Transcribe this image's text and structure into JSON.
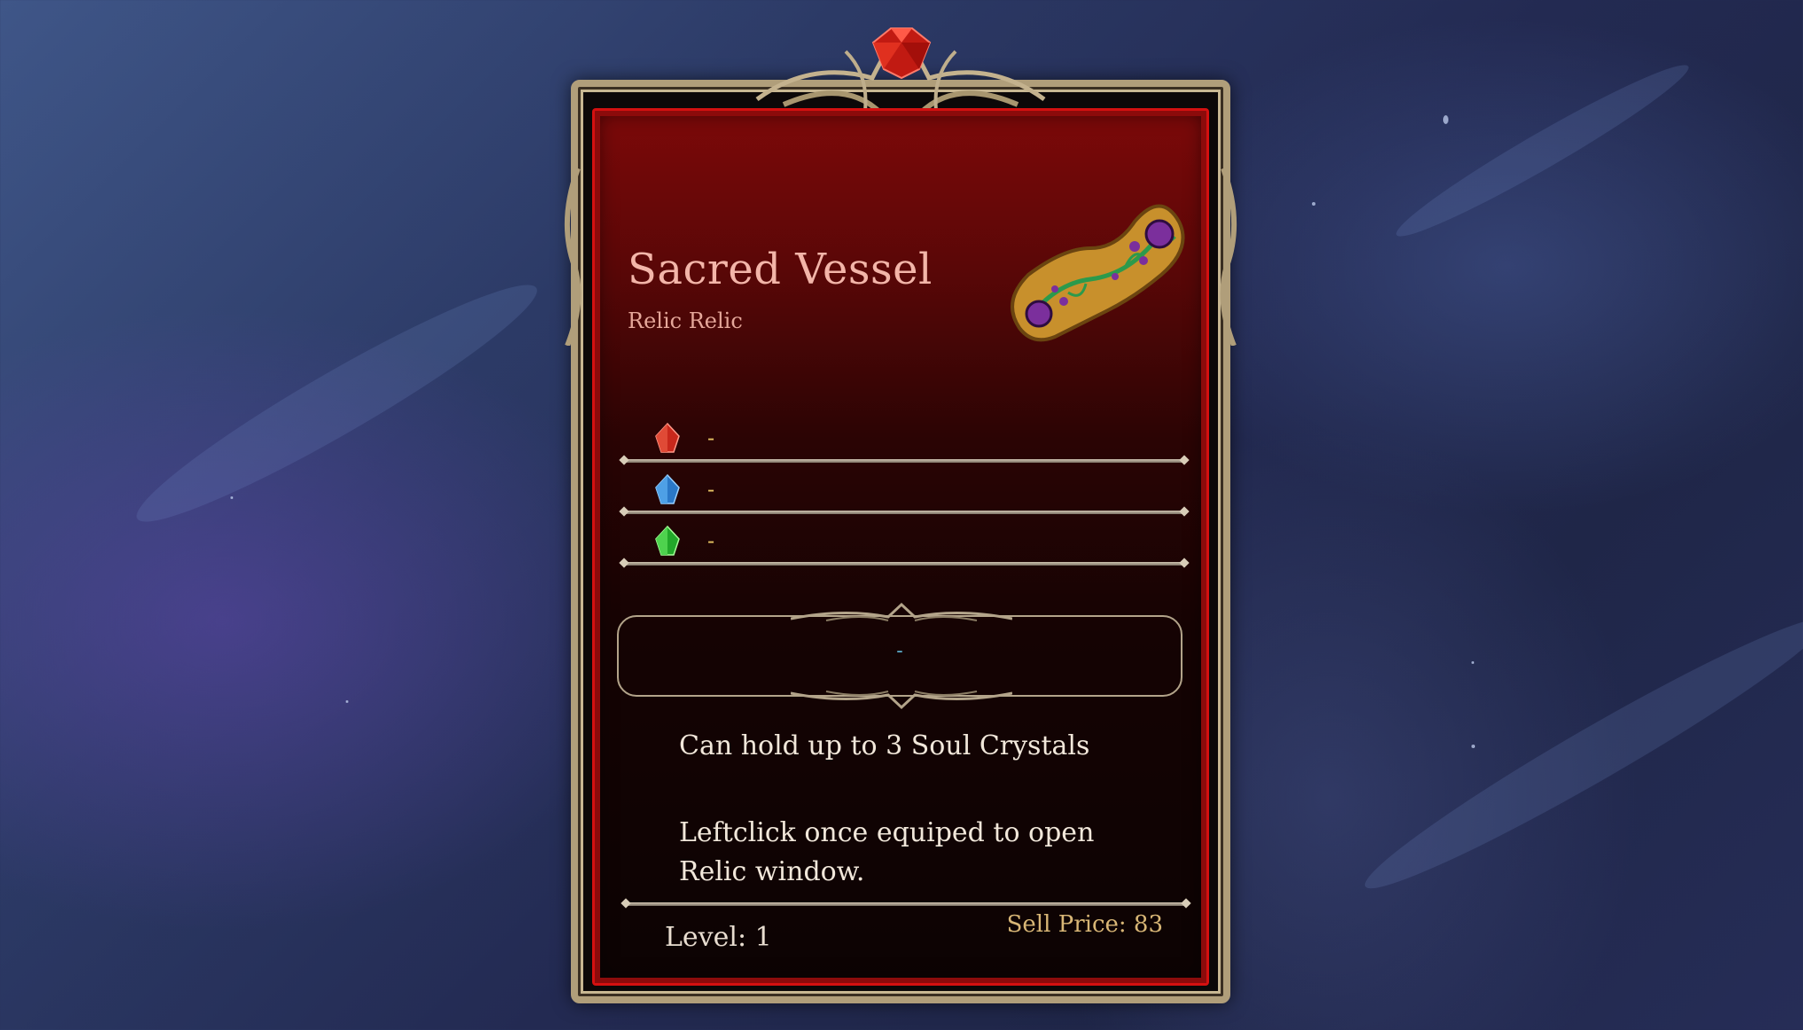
{
  "item": {
    "name": "Sacred Vessel",
    "type": "Relic Relic",
    "image_icon": "relic-vessel-icon"
  },
  "crystals": [
    {
      "icon": "red-crystal-icon",
      "color": "#d73a2a",
      "value": "-"
    },
    {
      "icon": "blue-crystal-icon",
      "color": "#3a8fd9",
      "value": "-"
    },
    {
      "icon": "green-crystal-icon",
      "color": "#36c23a",
      "value": "-"
    }
  ],
  "socket": {
    "value": "-"
  },
  "description": [
    "Can hold up to 3 Soul Crystals",
    "Leftclick once equiped to open Relic window."
  ],
  "footer": {
    "level": "Level: 1",
    "sell_price": "Sell Price: 83"
  },
  "colors": {
    "frame_gold": "#b09e7a",
    "frame_red": "#d51010",
    "title_pink": "#f3b5a9",
    "value_gold": "#e6c463"
  }
}
